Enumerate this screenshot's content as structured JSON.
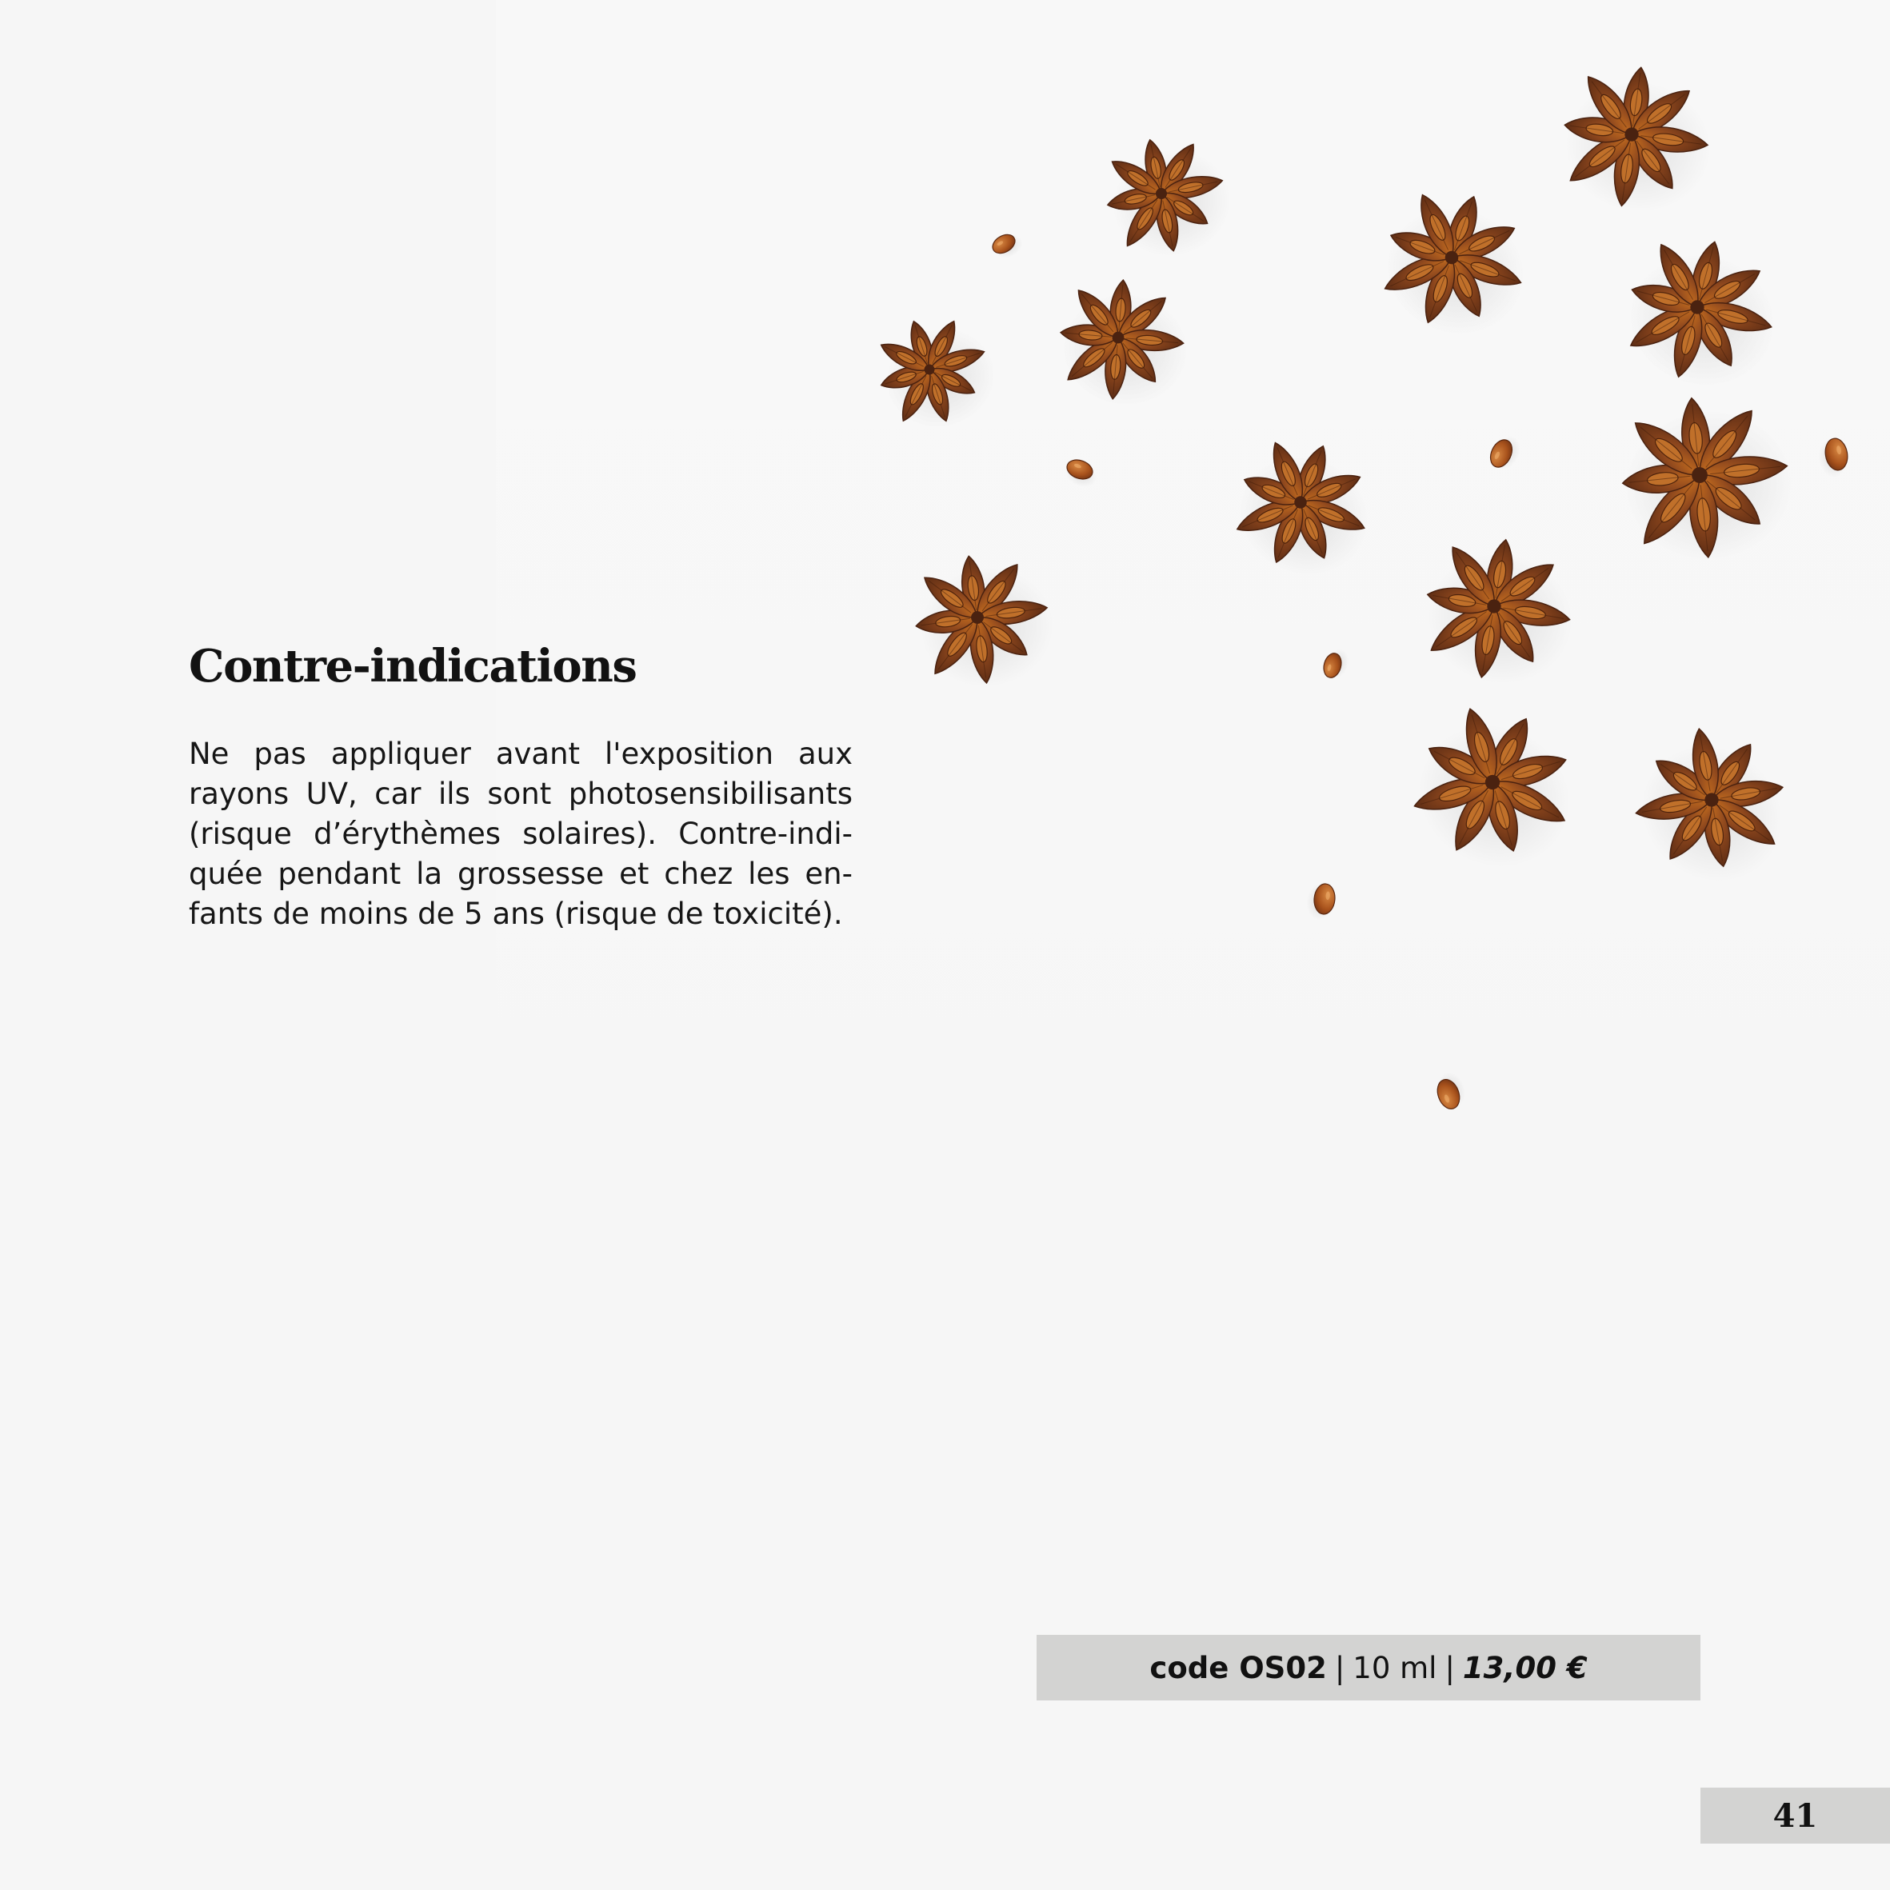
{
  "contraindications": {
    "title": "Contre-indications",
    "text": "Ne pas appliquer avant l'exposition aux rayons UV, car ils sont photosensibilisants (risque d’érythèmes solaires). Contre-indi­quée pendant la grossesse et chez les en­fants de moins de 5 ans (risque de toxicité)."
  },
  "product": {
    "code": "code OS02",
    "volume": "10 ml",
    "price": "13,00 €",
    "separator": "|"
  },
  "page": {
    "number": "41"
  },
  "image": {
    "subject_icon": "star-anise-icon",
    "colors": {
      "pod_dark": "#5e2d14",
      "pod_mid": "#8c461d",
      "pod_light": "#b9651f",
      "seed": "#a8521c",
      "background": "#f6f6f6",
      "bar": "#d3d3d2"
    }
  }
}
